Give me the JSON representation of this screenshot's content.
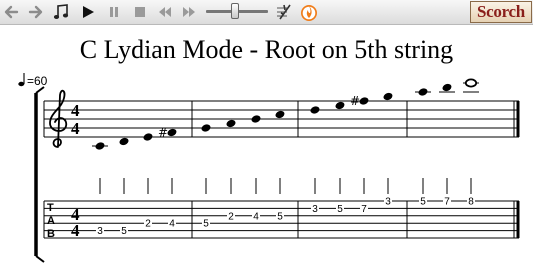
{
  "toolbar": {
    "buttons": [
      {
        "name": "back-arrow-icon"
      },
      {
        "name": "forward-arrow-icon"
      },
      {
        "name": "music-note-icon"
      },
      {
        "name": "play-icon"
      },
      {
        "name": "pause-icon"
      },
      {
        "name": "stop-icon"
      },
      {
        "name": "rewind-icon"
      },
      {
        "name": "fast-forward-icon"
      },
      {
        "name": "metronome-icon"
      },
      {
        "name": "flame-icon"
      }
    ],
    "logo": "Scorch"
  },
  "score": {
    "title": "C Lydian Mode - Root on 5th string",
    "tempo": "=60",
    "time_signature": {
      "top": "4",
      "bottom": "4"
    },
    "tab_label": [
      "T",
      "A",
      "B"
    ],
    "notes": [
      {
        "measure": 1,
        "staff_step": -2,
        "string": 5,
        "fret": "3",
        "accidental": ""
      },
      {
        "measure": 1,
        "staff_step": -1,
        "string": 5,
        "fret": "5",
        "accidental": ""
      },
      {
        "measure": 1,
        "staff_step": 0,
        "string": 4,
        "fret": "2",
        "accidental": ""
      },
      {
        "measure": 1,
        "staff_step": 1,
        "string": 4,
        "fret": "4",
        "accidental": "#"
      },
      {
        "measure": 2,
        "staff_step": 2,
        "string": 4,
        "fret": "5",
        "accidental": ""
      },
      {
        "measure": 2,
        "staff_step": 3,
        "string": 3,
        "fret": "2",
        "accidental": ""
      },
      {
        "measure": 2,
        "staff_step": 4,
        "string": 3,
        "fret": "4",
        "accidental": ""
      },
      {
        "measure": 2,
        "staff_step": 5,
        "string": 3,
        "fret": "5",
        "accidental": ""
      },
      {
        "measure": 3,
        "staff_step": 6,
        "string": 2,
        "fret": "3",
        "accidental": ""
      },
      {
        "measure": 3,
        "staff_step": 7,
        "string": 2,
        "fret": "5",
        "accidental": ""
      },
      {
        "measure": 3,
        "staff_step": 8,
        "string": 2,
        "fret": "7",
        "accidental": "#"
      },
      {
        "measure": 3,
        "staff_step": 9,
        "string": 1,
        "fret": "3",
        "accidental": ""
      },
      {
        "measure": 4,
        "staff_step": 10,
        "string": 1,
        "fret": "5",
        "accidental": ""
      },
      {
        "measure": 4,
        "staff_step": 11,
        "string": 1,
        "fret": "7",
        "accidental": ""
      },
      {
        "measure": 4,
        "staff_step": 12,
        "string": 1,
        "fret": "8",
        "accidental": "",
        "whole": true
      }
    ]
  }
}
